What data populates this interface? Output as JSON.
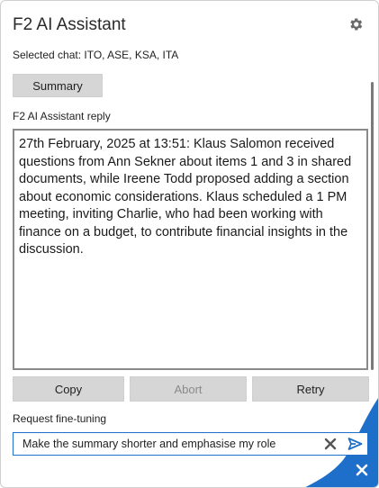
{
  "header": {
    "title": "F2 AI Assistant",
    "settings_icon": "gear-icon"
  },
  "selected_chat": "Selected chat: ITO, ASE, KSA, ITA",
  "buttons": {
    "summary": "Summary",
    "copy": "Copy",
    "abort": "Abort",
    "retry": "Retry"
  },
  "reply": {
    "label": "F2 AI Assistant reply",
    "text": "27th February, 2025 at 13:51: Klaus Salomon received questions from Ann Sekner about items 1 and 3 in shared documents, while Ireene Todd proposed adding a section about economic considerations. Klaus scheduled a 1 PM meeting, inviting Charlie, who had been working with finance on a budget, to contribute financial insights in the discussion."
  },
  "fine_tuning": {
    "label": "Request fine-tuning",
    "value": "Make the summary shorter and emphasise my role",
    "clear_icon": "clear-icon",
    "send_icon": "send-icon"
  },
  "close_icon": "close-icon",
  "colors": {
    "accent": "#1e6fc9",
    "button_bg": "#d6d6d6",
    "disabled_text": "#8a8a8a"
  }
}
